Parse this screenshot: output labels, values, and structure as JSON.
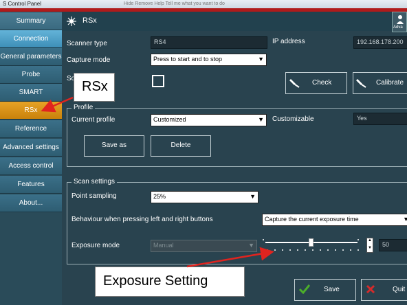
{
  "window": {
    "title": "S Control Panel",
    "menu_hint": "Hide   Remove   Help   Tell me what you want to do"
  },
  "sidebar": {
    "items": [
      {
        "label": "Summary"
      },
      {
        "label": "Connection"
      },
      {
        "label": "General parameters"
      },
      {
        "label": "Probe"
      },
      {
        "label": "SMART"
      },
      {
        "label": "RSx"
      },
      {
        "label": "Reference"
      },
      {
        "label": "Advanced settings"
      },
      {
        "label": "Access control"
      },
      {
        "label": "Features"
      },
      {
        "label": "About..."
      }
    ],
    "selected": "RSx"
  },
  "header": {
    "title": "RSx",
    "advanced_label": "Adva"
  },
  "scanner": {
    "type_label": "Scanner type",
    "type_value": "RS4",
    "ip_label": "IP address",
    "ip_value": "192.168.178.200",
    "capture_label": "Capture mode",
    "capture_value": "Press to start and to stop",
    "so_label": "So",
    "check_label": "Check",
    "calibrate_label": "Calibrate"
  },
  "profile": {
    "group_title": "Profile",
    "current_label": "Current profile",
    "current_value": "Customized",
    "customizable_label": "Customizable",
    "customizable_value": "Yes",
    "save_as_label": "Save as",
    "delete_label": "Delete"
  },
  "scan_settings": {
    "group_title": "Scan settings",
    "point_sampling_label": "Point sampling",
    "point_sampling_value": "25%",
    "behaviour_label": "Behaviour when pressing left and right buttons",
    "behaviour_value": "Capture the current exposure time",
    "exposure_mode_label": "Exposure mode",
    "exposure_mode_value": "Manual",
    "exposure_value": "50",
    "exposure_level_fraction": 0.5
  },
  "footer": {
    "save_label": "Save",
    "quit_label": "Quit"
  },
  "annotations": {
    "rsx_callout": "RSx",
    "exposure_callout": "Exposure Setting"
  },
  "colors": {
    "accent_selected": "#d9930f",
    "arrow": "#e0241f",
    "check_green": "#4caf2a",
    "quit_red": "#d42b2b"
  }
}
